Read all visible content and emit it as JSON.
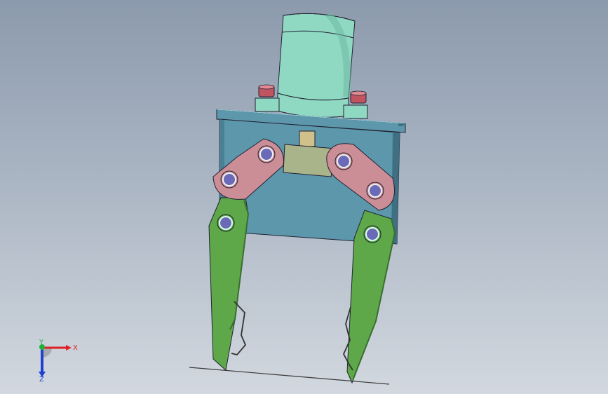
{
  "viewport": {
    "model": "gripper-assembly"
  },
  "triad": {
    "x_label": "X",
    "y_label": "Y",
    "z_label": "Z"
  },
  "colors": {
    "background_top": "#8c9aad",
    "background_bottom": "#d2d8df",
    "motor": "#8fd8c2",
    "base_plate": "#5c97ab",
    "links": "#cc8e96",
    "bushing": "#d0c08a",
    "bracket": "#aab48a",
    "fingers": "#5ea84a",
    "pins": "#6a6ab8",
    "bolt_heads": "#c05560",
    "axis_x": "#e02020",
    "axis_y": "#20b040",
    "axis_z": "#2040d0"
  }
}
